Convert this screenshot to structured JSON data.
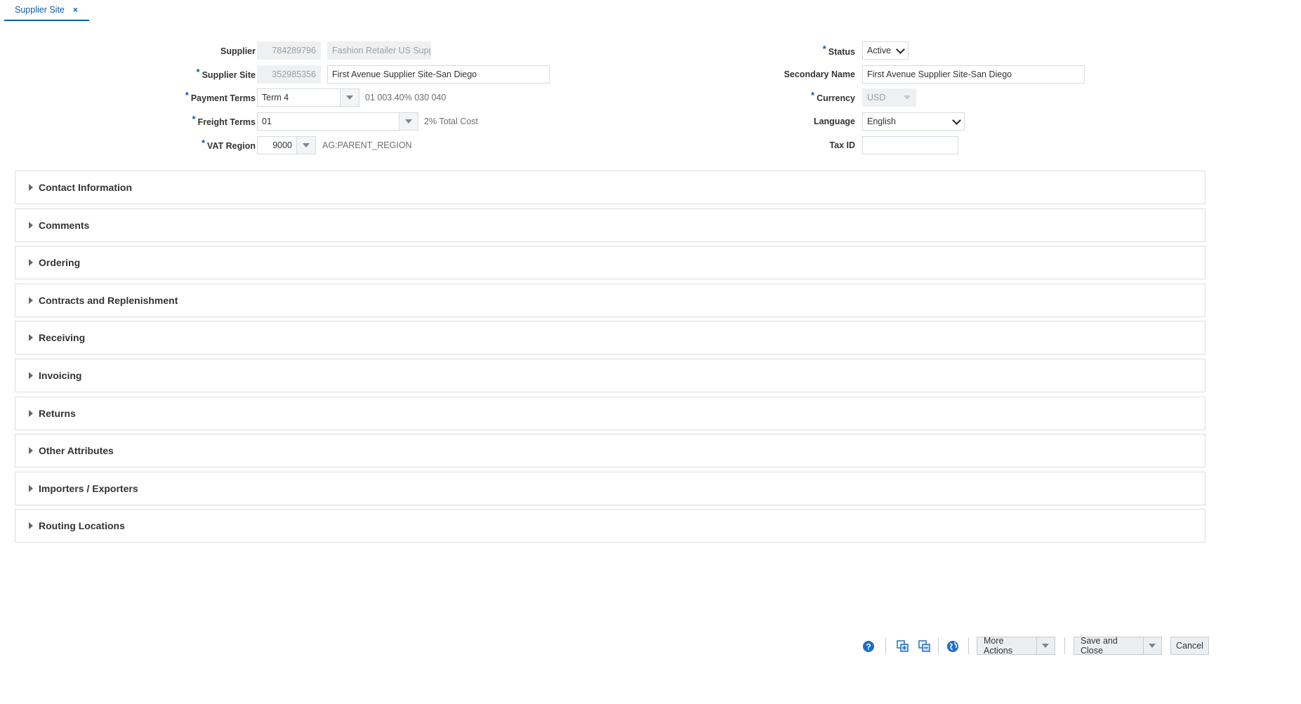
{
  "tab": {
    "label": "Supplier Site",
    "close": "×"
  },
  "form": {
    "supplier": {
      "label": "Supplier",
      "id": "784289796",
      "name": "Fashion Retailer US Supplie"
    },
    "supplier_site": {
      "label": "Supplier Site",
      "id": "352985356",
      "name": "First Avenue Supplier Site-San Diego"
    },
    "payment_terms": {
      "label": "Payment Terms",
      "value": "Term 4",
      "description": "01 003.40% 030 040"
    },
    "freight_terms": {
      "label": "Freight Terms",
      "value": "01",
      "description": "2% Total Cost"
    },
    "vat_region": {
      "label": "VAT Region",
      "value": "9000",
      "description": "AG:PARENT_REGION"
    },
    "status": {
      "label": "Status",
      "value": "Active"
    },
    "secondary_name": {
      "label": "Secondary Name",
      "value": "First Avenue Supplier Site-San Diego"
    },
    "currency": {
      "label": "Currency",
      "value": "USD"
    },
    "language": {
      "label": "Language",
      "value": "English"
    },
    "tax_id": {
      "label": "Tax ID",
      "value": ""
    },
    "required_marker": "*"
  },
  "sections": [
    "Contact Information",
    "Comments",
    "Ordering",
    "Contracts and Replenishment",
    "Receiving",
    "Invoicing",
    "Returns",
    "Other Attributes",
    "Importers / Exporters",
    "Routing Locations"
  ],
  "footer": {
    "more_actions": "More Actions",
    "save_and_close": "Save and Close",
    "cancel": "Cancel"
  },
  "colors": {
    "accent": "#0b5ca8",
    "icon_blue": "#1f6fc5"
  }
}
